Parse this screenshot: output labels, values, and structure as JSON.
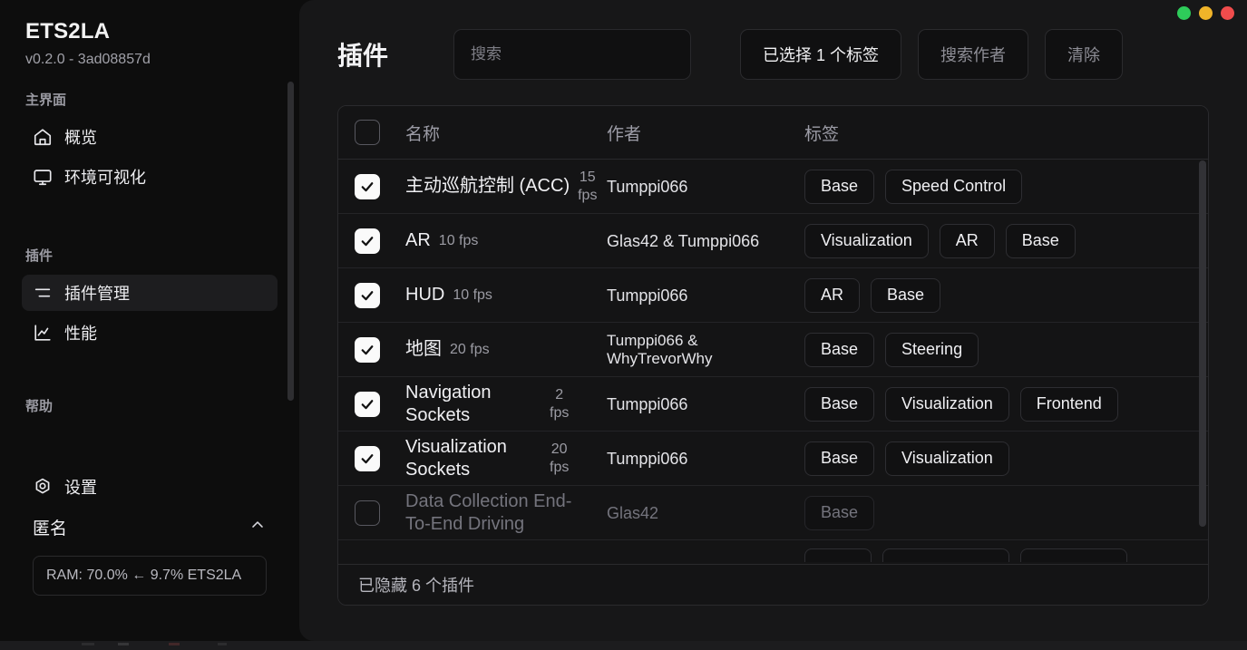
{
  "app": {
    "brand": "ETS2LA",
    "version": "v0.2.0 - 3ad08857d"
  },
  "window_controls": {
    "minimize": {
      "name": "minimize",
      "color": "#2ecc5a"
    },
    "maximize": {
      "name": "maximize",
      "color": "#f0b429"
    },
    "close": {
      "name": "close",
      "color": "#f04c4c"
    }
  },
  "sidebar": {
    "groups": [
      {
        "label": "主界面",
        "items": [
          {
            "label": "概览",
            "icon": "home-icon",
            "active": false
          },
          {
            "label": "环境可视化",
            "icon": "monitor-icon",
            "active": false
          }
        ]
      },
      {
        "label": "插件",
        "items": [
          {
            "label": "插件管理",
            "icon": "sliders-icon",
            "active": true
          },
          {
            "label": "性能",
            "icon": "chart-icon",
            "active": false
          }
        ]
      },
      {
        "label": "帮助",
        "items": [
          {
            "label": "设置",
            "icon": "gear-icon",
            "active": false
          }
        ]
      }
    ],
    "account": {
      "label": "匿名",
      "chevron": "chevron-up-icon"
    },
    "ram_status": "RAM: 70.0% ← 9.7% ETS2LA"
  },
  "header": {
    "title": "插件",
    "search_placeholder": "搜索",
    "search_value": "",
    "tag_filter_label": "已选择 1 个标签",
    "author_filter_label": "搜索作者",
    "clear_label": "清除"
  },
  "table": {
    "columns": [
      "名称",
      "作者",
      "标签"
    ],
    "header_checkbox_checked": false,
    "rows": [
      {
        "checked": true,
        "enabled": true,
        "name": "主动巡航控制 (ACC)",
        "fps": "15\nfps",
        "author": "Tumppi066",
        "tags": [
          "Base",
          "Speed Control"
        ]
      },
      {
        "checked": true,
        "enabled": true,
        "name": "AR",
        "fps": "10 fps",
        "author": "Glas42 & Tumppi066",
        "tags": [
          "Visualization",
          "AR",
          "Base"
        ]
      },
      {
        "checked": true,
        "enabled": true,
        "name": "HUD",
        "fps": "10 fps",
        "author": "Tumppi066",
        "tags": [
          "AR",
          "Base"
        ]
      },
      {
        "checked": true,
        "enabled": true,
        "name": "地图",
        "fps": "20 fps",
        "author": "Tumppi066 & WhyTrevorWhy",
        "tags": [
          "Base",
          "Steering"
        ]
      },
      {
        "checked": true,
        "enabled": true,
        "name": "Navigation Sockets",
        "fps": "2\nfps",
        "author": "Tumppi066",
        "tags": [
          "Base",
          "Visualization",
          "Frontend"
        ]
      },
      {
        "checked": true,
        "enabled": true,
        "name": "Visualization Sockets",
        "fps": "20\nfps",
        "author": "Tumppi066",
        "tags": [
          "Base",
          "Visualization"
        ]
      },
      {
        "checked": false,
        "enabled": false,
        "name": "Data Collection End-To-End Driving",
        "fps": "",
        "author": "Glas42",
        "tags": [
          "Base"
        ]
      },
      {
        "checked": false,
        "enabled": true,
        "clipped": true,
        "name": "",
        "fps": "",
        "author": "",
        "tags": [
          "",
          "",
          ""
        ]
      }
    ],
    "footer_text": "已隐藏 6 个插件"
  }
}
